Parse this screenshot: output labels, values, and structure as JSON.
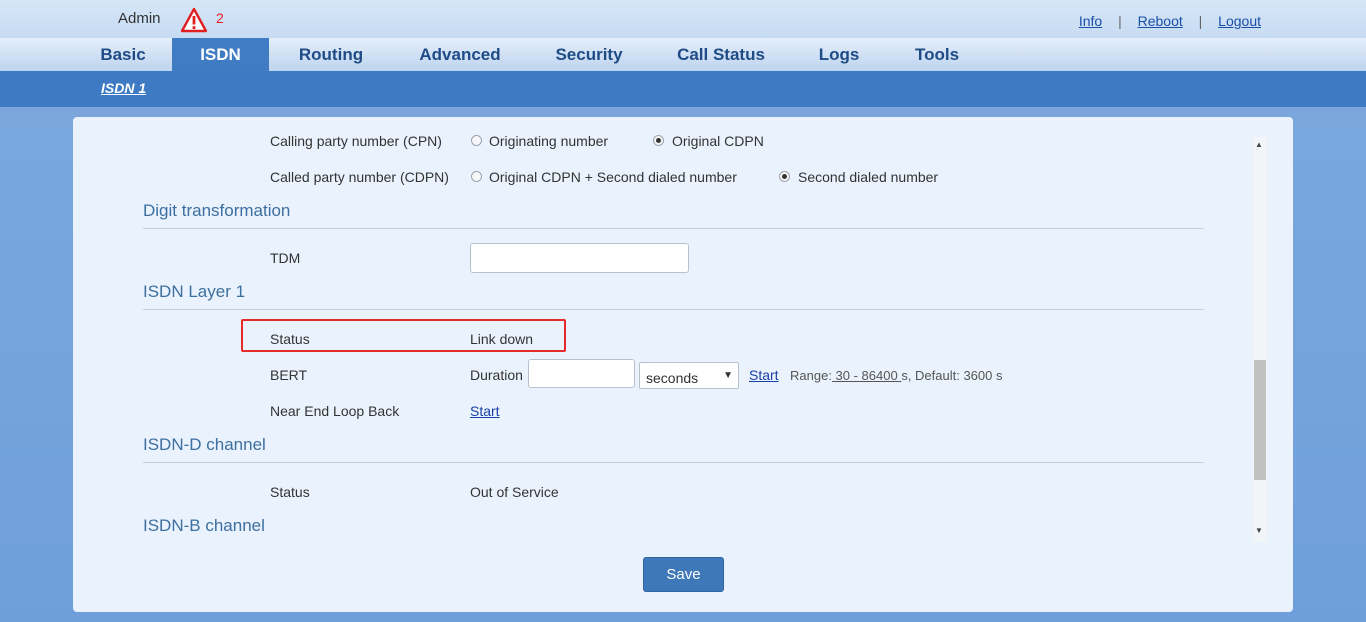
{
  "header": {
    "user": "Admin",
    "alert_count": "2",
    "links": {
      "info": "Info",
      "reboot": "Reboot",
      "logout": "Logout"
    },
    "separator": "|"
  },
  "nav": {
    "items": [
      {
        "label": "Basic"
      },
      {
        "label": "ISDN"
      },
      {
        "label": "Routing"
      },
      {
        "label": "Advanced"
      },
      {
        "label": "Security"
      },
      {
        "label": "Call Status"
      },
      {
        "label": "Logs"
      },
      {
        "label": "Tools"
      }
    ],
    "active": "ISDN"
  },
  "subnav": {
    "tab": "ISDN 1"
  },
  "form": {
    "cpn": {
      "label": "Calling party number (CPN)",
      "options": [
        {
          "label": "Originating number",
          "selected": false
        },
        {
          "label": "Original CDPN",
          "selected": true
        }
      ]
    },
    "cdpn": {
      "label": "Called party number (CDPN)",
      "options": [
        {
          "label": "Original CDPN + Second dialed number",
          "selected": false
        },
        {
          "label": "Second dialed number",
          "selected": true
        }
      ]
    },
    "digit_transformation": {
      "title": "Digit transformation",
      "tdm_label": "TDM",
      "tdm_value": ""
    },
    "layer1": {
      "title": "ISDN Layer 1",
      "status_label": "Status",
      "status_value": "Link down",
      "bert_label": "BERT",
      "duration_label": "Duration",
      "duration_value": "",
      "duration_unit": "seconds",
      "start_label": "Start",
      "range_label": "Range:",
      "range_value": " 30 - 86400 ",
      "range_suffix": "s, Default: 3600 s",
      "near_end_label": "Near End Loop Back",
      "near_end_start": "Start"
    },
    "dchannel": {
      "title": "ISDN-D channel",
      "status_label": "Status",
      "status_value": "Out of Service"
    },
    "bchannel": {
      "title": "ISDN-B channel"
    }
  },
  "actions": {
    "save": "Save"
  },
  "colors": {
    "accent": "#3f7cc4",
    "highlight": "#e52a2a",
    "alert": "#e02020"
  }
}
